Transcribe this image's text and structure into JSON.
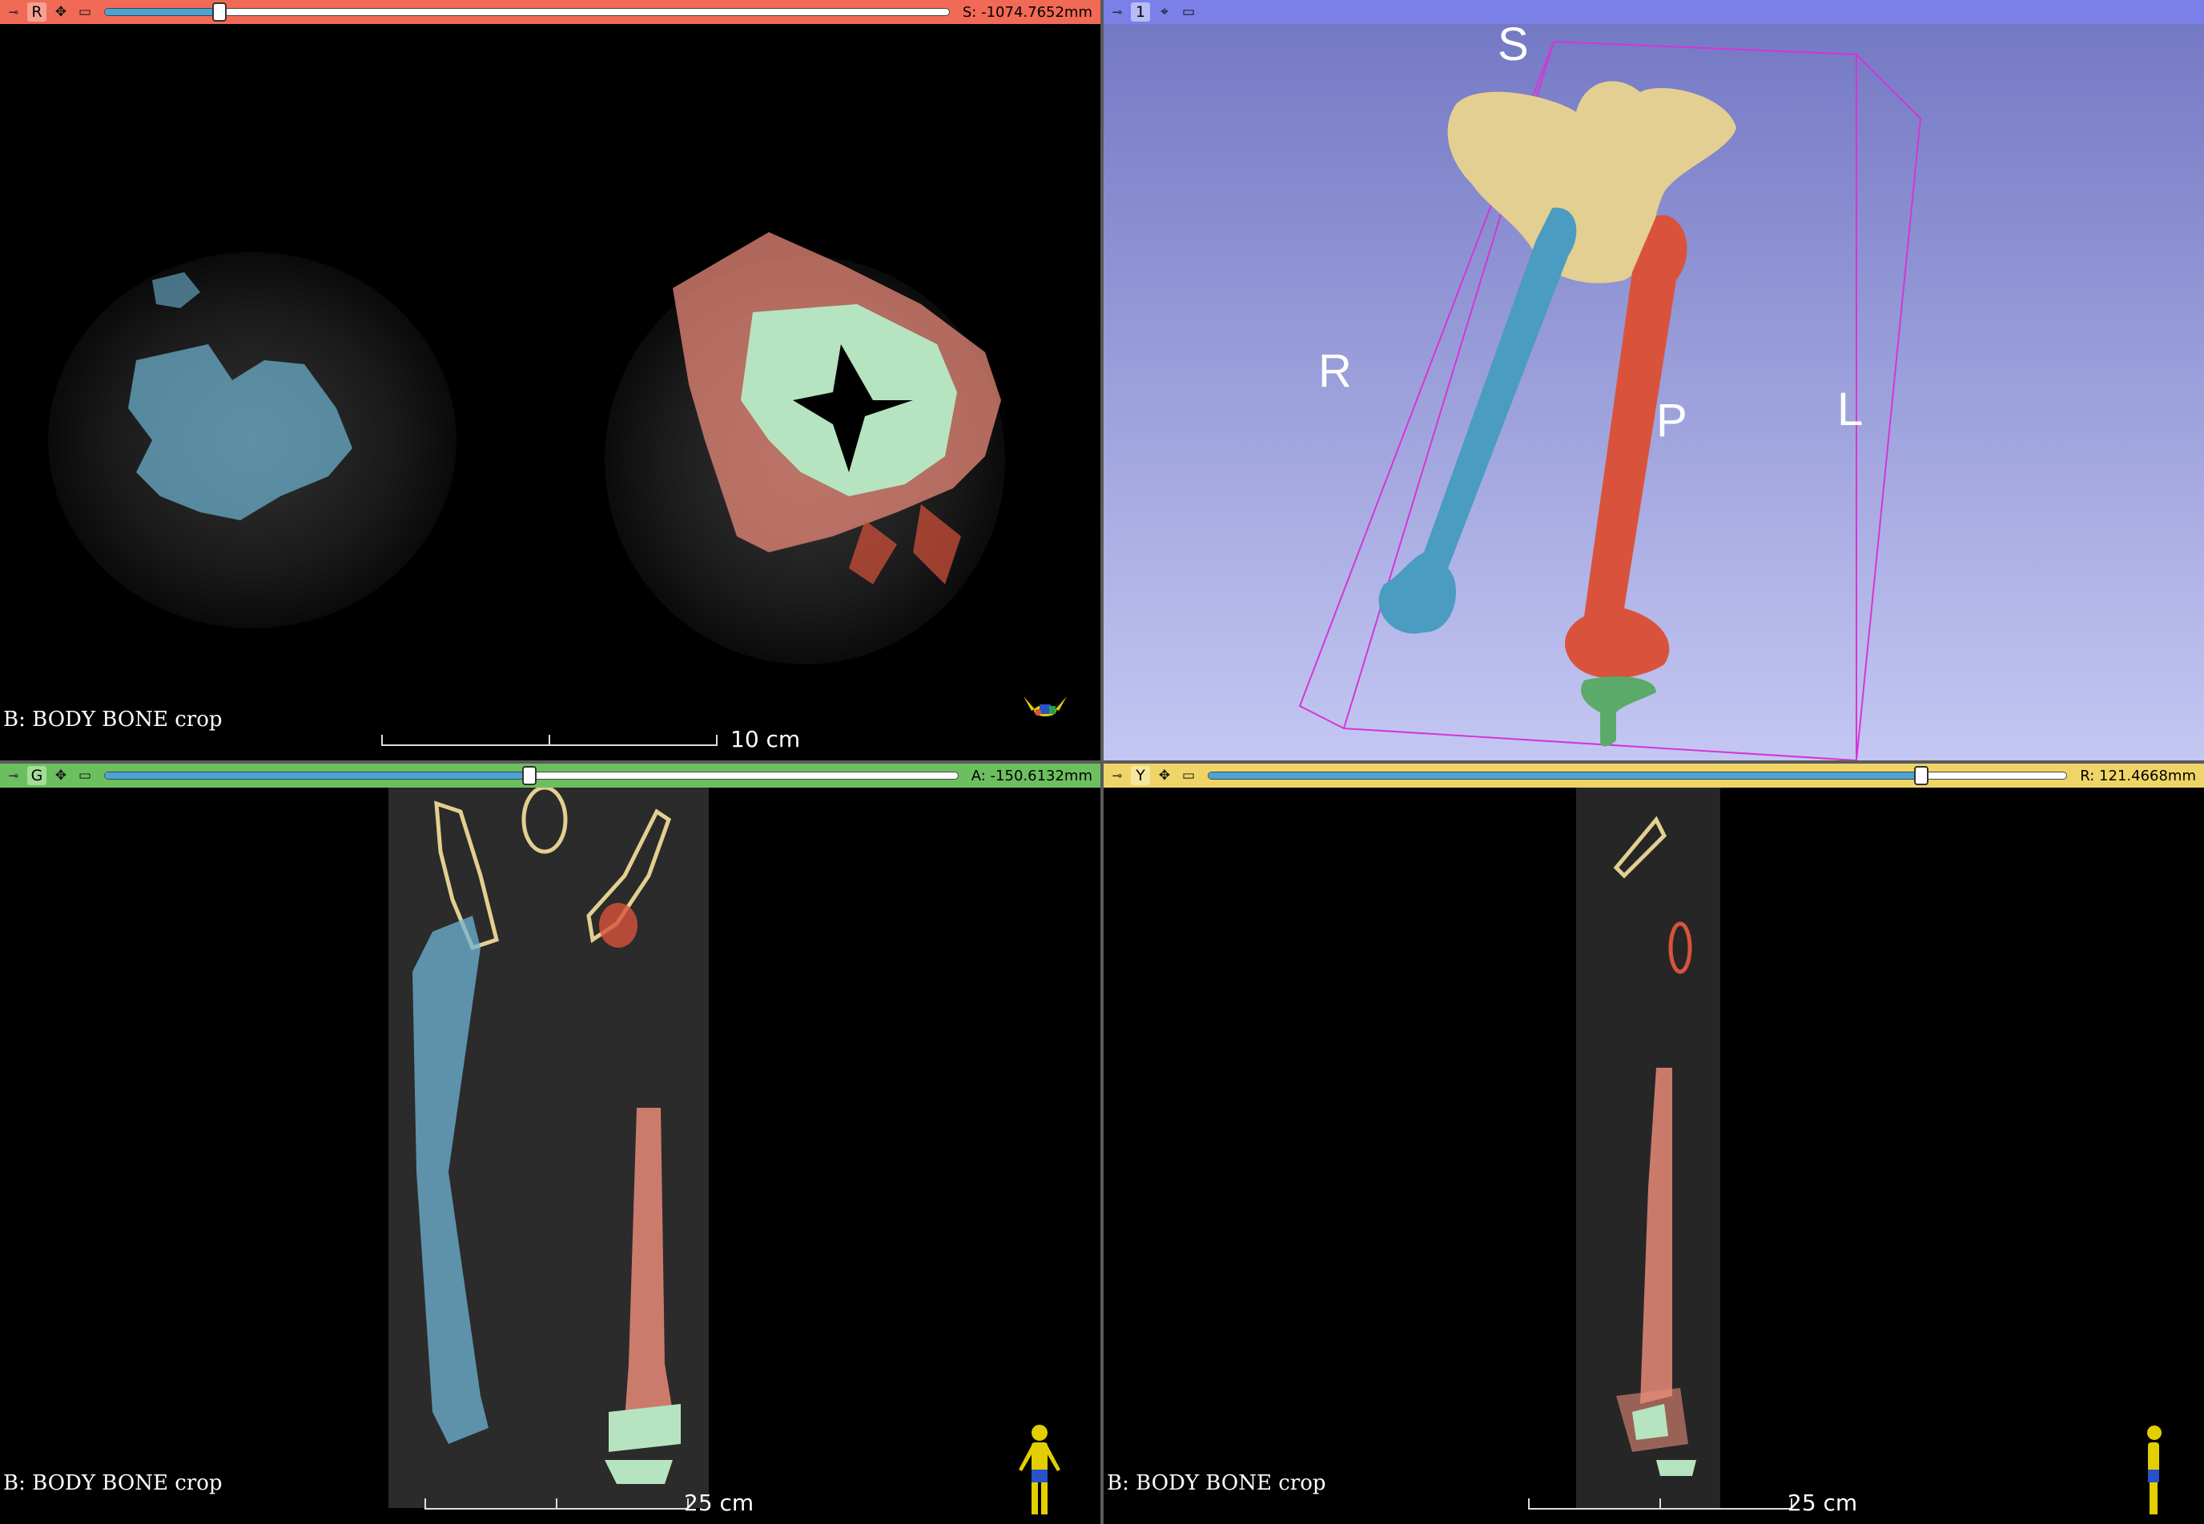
{
  "views": {
    "red": {
      "letter": "R",
      "offset": "S: -1074.7652mm",
      "slider_fraction": 0.136,
      "volume_label": "B: BODY BONE crop",
      "scale_label": "10 cm"
    },
    "threed": {
      "letter": "1",
      "orientation": {
        "superior": "S",
        "right": "R",
        "left": "L",
        "posterior": "P"
      }
    },
    "green": {
      "letter": "G",
      "offset": "A: -150.6132mm",
      "slider_fraction": 0.498,
      "volume_label": "B: BODY BONE crop",
      "scale_label": "25 cm"
    },
    "yellow": {
      "letter": "Y",
      "offset": "R: 121.4668mm",
      "slider_fraction": 0.83,
      "volume_label": "B: BODY BONE crop",
      "scale_label": "25 cm"
    }
  },
  "colors": {
    "red_bar": "#f16a56",
    "threed_bar": "#7b80e8",
    "green_bar": "#6cbf5f",
    "yellow_bar": "#efd567",
    "seg_femur_right": "#4a9cc1",
    "seg_femur_left": "#d9533c",
    "seg_pelvis": "#e3cf91",
    "seg_tibia": "#5caa6a"
  },
  "icons": {
    "pin": "pin-icon",
    "link": "link-icon",
    "maximize": "maximize-view-icon",
    "crosshair": "crosshair-icon"
  }
}
